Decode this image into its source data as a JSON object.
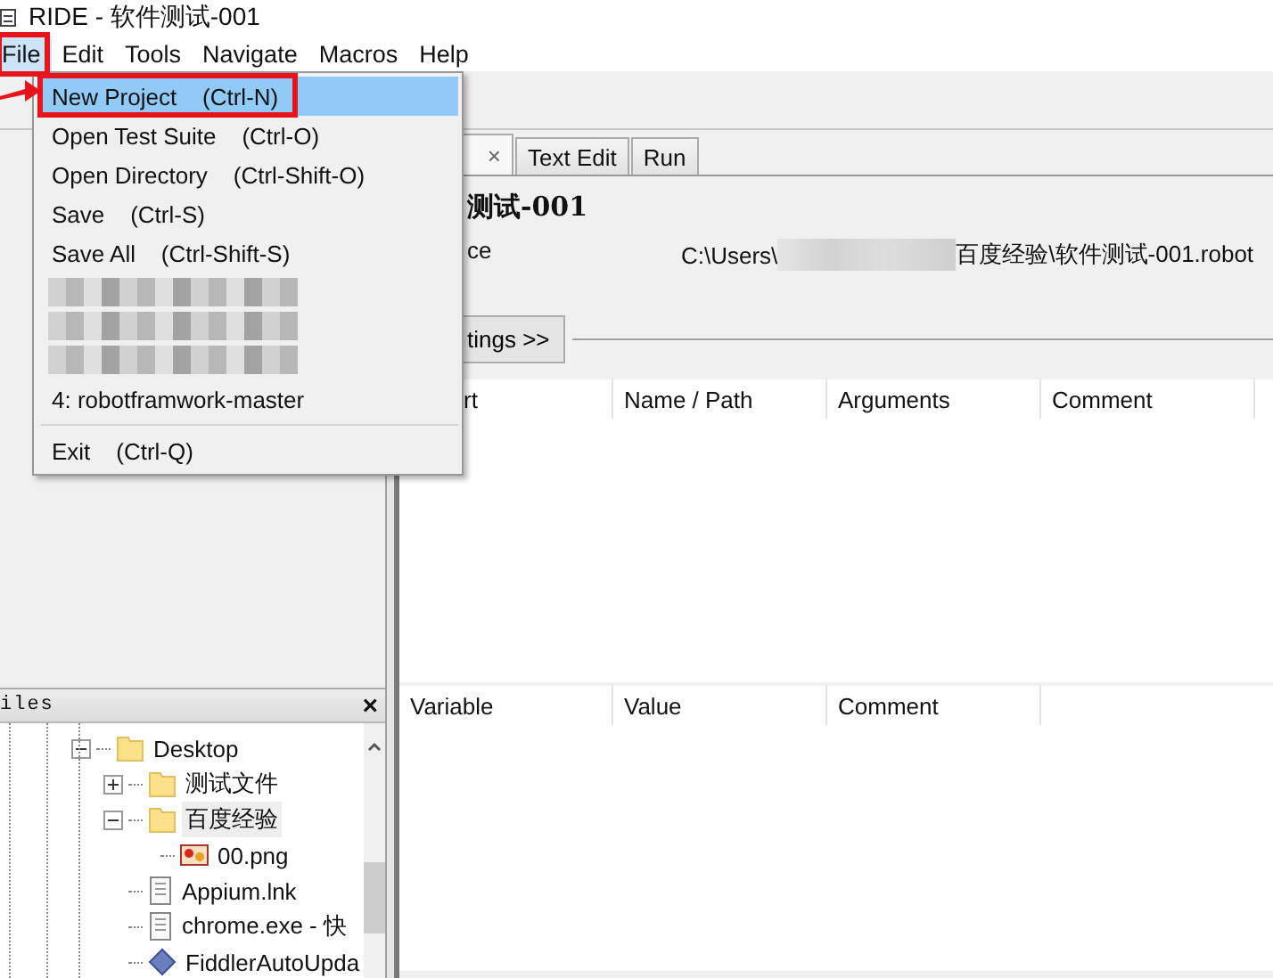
{
  "window": {
    "title": "RIDE - 软件测试-001"
  },
  "menubar": [
    {
      "label": "File",
      "selected": true
    },
    {
      "label": "Edit",
      "selected": false
    },
    {
      "label": "Tools",
      "selected": false
    },
    {
      "label": "Navigate",
      "selected": false
    },
    {
      "label": "Macros",
      "selected": false
    },
    {
      "label": "Help",
      "selected": false
    }
  ],
  "file_menu": [
    {
      "kind": "command",
      "label": "New Project",
      "shortcut": "(Ctrl-N)",
      "selected": true
    },
    {
      "kind": "command",
      "label": "Open Test Suite",
      "shortcut": "(Ctrl-O)",
      "selected": false
    },
    {
      "kind": "command",
      "label": "Open Directory",
      "shortcut": "(Ctrl-Shift-O)",
      "selected": false
    },
    {
      "kind": "command",
      "label": "Save",
      "shortcut": "(Ctrl-S)",
      "selected": false
    },
    {
      "kind": "command",
      "label": "Save All",
      "shortcut": "(Ctrl-Shift-S)",
      "selected": false
    },
    {
      "kind": "blurred",
      "selected": false
    },
    {
      "kind": "blurred",
      "selected": false
    },
    {
      "kind": "blurred",
      "selected": false
    },
    {
      "kind": "command",
      "label": "4: robotframwork-master",
      "selected": false
    },
    {
      "kind": "separator"
    },
    {
      "kind": "command",
      "label": "Exit",
      "shortcut": "(Ctrl-Q)",
      "selected": false
    }
  ],
  "editor_tabs": [
    {
      "kind": "close-only",
      "close": "×",
      "selected": true
    },
    {
      "kind": "tab",
      "label": "Text Edit",
      "selected": false
    },
    {
      "kind": "tab",
      "label": "Run",
      "selected": false
    }
  ],
  "suite": {
    "title": "测试-001",
    "source_label": "ce",
    "source_path_start": "C:\\Users\\",
    "source_path_end": "百度经验\\软件测试-001.robot",
    "settings_button": "tings >>"
  },
  "import_table": {
    "columns": [
      "rt",
      "Name / Path",
      "Arguments",
      "Comment"
    ]
  },
  "variable_table": {
    "columns": [
      "Variable",
      "Value",
      "Comment"
    ]
  },
  "files_panel": {
    "title": "iles",
    "close": "×",
    "tree": [
      {
        "label": "Desktop",
        "kind": "folder",
        "expanded": true,
        "selected": false,
        "children": [
          {
            "label": "测试文件",
            "kind": "folder",
            "expanded": false,
            "selected": false
          },
          {
            "label": "百度经验",
            "kind": "folder",
            "expanded": true,
            "selected": true,
            "children": [
              {
                "label": "00.png",
                "kind": "image",
                "selected": false
              }
            ]
          },
          {
            "label": "Appium.lnk",
            "kind": "file",
            "selected": false
          },
          {
            "label": "chrome.exe - 快",
            "kind": "file",
            "selected": false
          },
          {
            "label": "FiddlerAutoUpda",
            "kind": "diamond",
            "selected": false
          }
        ]
      }
    ]
  }
}
